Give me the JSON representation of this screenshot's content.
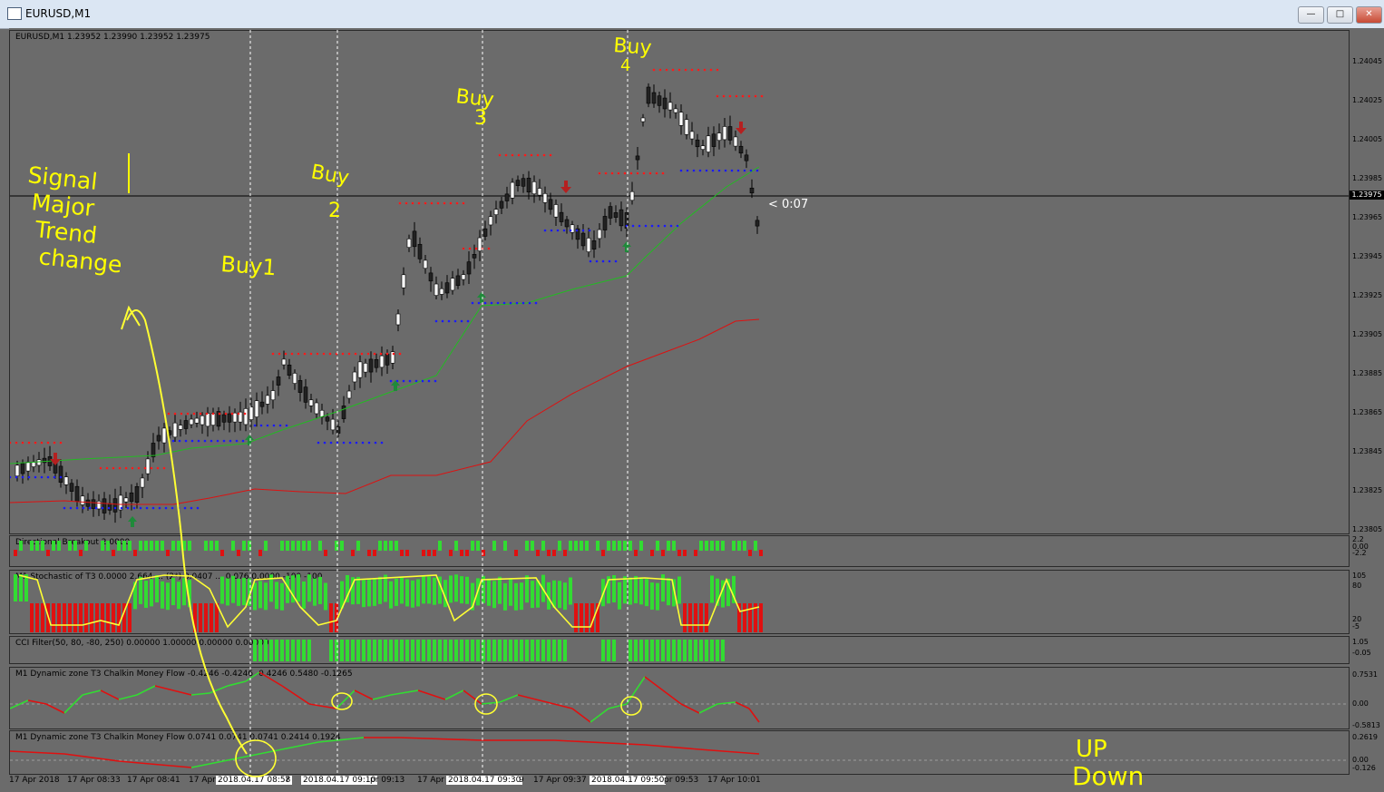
{
  "window": {
    "title": "EURUSD,M1"
  },
  "main_pane": {
    "header": "EURUSD,M1  1.23952 1.23990 1.23952 1.23975",
    "price_ticks": [
      "1.24045",
      "1.24025",
      "1.24005",
      "1.23985",
      "1.23965",
      "1.23945",
      "1.23925",
      "1.23905",
      "1.23885",
      "1.23865",
      "1.23845",
      "1.23825",
      "1.23805"
    ],
    "current_price": "1.23975",
    "countdown": "< 0:07"
  },
  "panes": [
    {
      "label": "Directional Breakout 2.0000",
      "ticks": [
        "2.2",
        "0.00",
        "-2.2"
      ]
    },
    {
      "label": "M1 Stochastic of T3 0.0000 2.664 ... (2*) 0.0407 ... 0.076 0.0000 -100 -100",
      "ticks": [
        "105",
        "80",
        "20",
        "-5"
      ]
    },
    {
      "label": "CCI Filter(50, 80, -80, 250) 0.00000 1.00000 0.00000 0.00000",
      "ticks": [
        "1.05",
        "-0.05"
      ]
    },
    {
      "label": "M1 Dynamic zone T3 Chalkin Money Flow  -0.4246 -0.4246 -0.4246 0.5480 -0.1265",
      "ticks": [
        "0.7531",
        "0.00",
        "-0.5813"
      ]
    },
    {
      "label": "M1 Dynamic zone T3 Chalkin Money Flow  0.0741 0.0741 0.0741 0.2414 0.1924",
      "ticks": [
        "0.2619",
        "0.00",
        "-0.126"
      ]
    }
  ],
  "time_axis": [
    {
      "label": "17 Apr 2018",
      "highlight": false
    },
    {
      "label": "17 Apr 08:33",
      "highlight": false
    },
    {
      "label": "17 Apr 08:41",
      "highlight": false
    },
    {
      "label": "17 Apr",
      "highlight": false
    },
    {
      "label": "2018.04.17 08:58",
      "highlight": true
    },
    {
      "label": "7",
      "highlight": false
    },
    {
      "label": "2018.04.17 09:10",
      "highlight": true
    },
    {
      "label": "pr 09:13",
      "highlight": false
    },
    {
      "label": "17 Apr",
      "highlight": false
    },
    {
      "label": "2018.04.17 09:30",
      "highlight": true
    },
    {
      "label": "9",
      "highlight": false
    },
    {
      "label": "17 Apr 09:37",
      "highlight": false
    },
    {
      "label": "2018.04.17 09:50",
      "highlight": true
    },
    {
      "label": "pr 09:53",
      "highlight": false
    },
    {
      "label": "17 Apr 10:01",
      "highlight": false
    }
  ],
  "annotations": {
    "signal_note": [
      "Signal",
      "Major",
      "Trend",
      "change"
    ],
    "buy1": "Buy1",
    "buy2": [
      "Buy",
      "2"
    ],
    "buy3": [
      "Buy",
      "3"
    ],
    "buy4": [
      "Buy",
      "4"
    ],
    "legend_up": "UP",
    "legend_down": "Down"
  },
  "colors": {
    "background": "#6b6b6b",
    "bull_bar": "#32dc32",
    "bear_bar": "#e01010",
    "signal_line": "#ffff33",
    "annotation": "#ffff00",
    "ma_fast": "#22bb22",
    "ma_slow": "#dd1111",
    "resistance_dots": "#ff1a1a",
    "support_dots": "#1a1aff"
  }
}
